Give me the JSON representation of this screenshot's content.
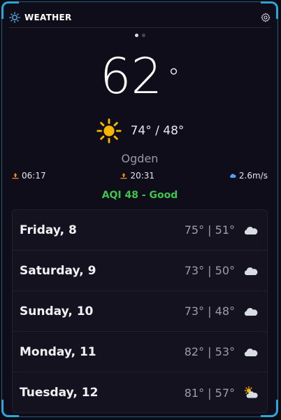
{
  "header": {
    "title": "WEATHER",
    "logo_icon": "sun-outline-icon",
    "settings_icon": "gear-icon"
  },
  "pager": {
    "count": 2,
    "active": 0
  },
  "current": {
    "temp": "62",
    "deg": "°",
    "hilo": "74° / 48°",
    "condition_icon": "sun-icon",
    "city": "Ogden"
  },
  "stats": {
    "sunrise": "06:17",
    "sunset": "20:31",
    "wind": "2.6m/s"
  },
  "aqi": {
    "text": "AQI 48 - Good",
    "color": "#3ec44d"
  },
  "forecast": [
    {
      "day": "Friday, 8",
      "temps": "75° | 51°",
      "icon": "cloud-icon"
    },
    {
      "day": "Saturday, 9",
      "temps": "73° | 50°",
      "icon": "cloud-icon"
    },
    {
      "day": "Sunday, 10",
      "temps": "73° | 48°",
      "icon": "cloud-icon"
    },
    {
      "day": "Monday, 11",
      "temps": "82° | 53°",
      "icon": "cloud-icon"
    },
    {
      "day": "Tuesday, 12",
      "temps": "81° | 57°",
      "icon": "partly-cloudy-icon"
    }
  ]
}
